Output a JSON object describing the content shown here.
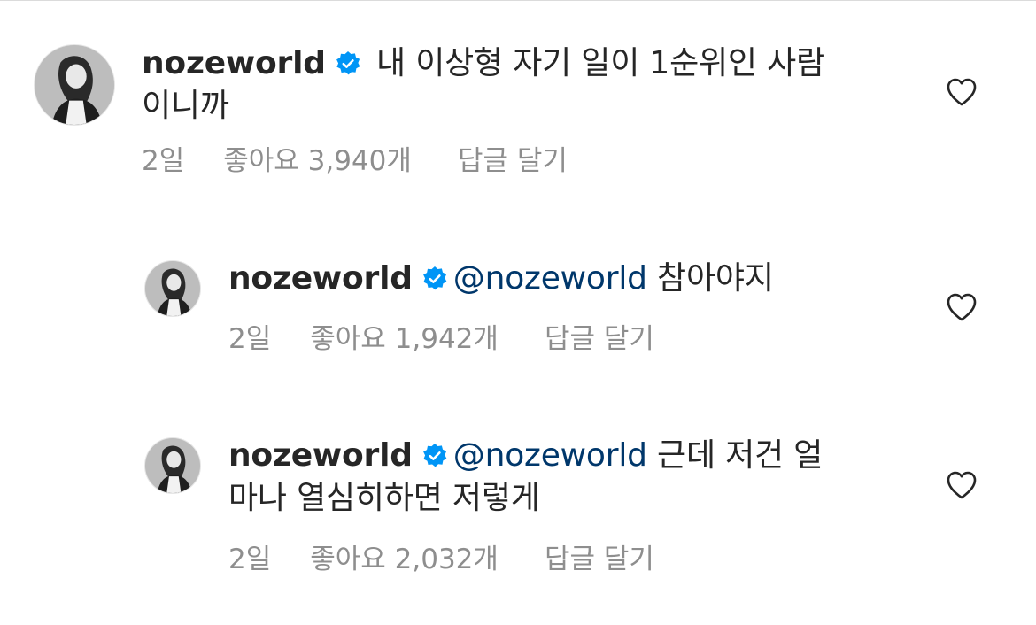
{
  "comments": [
    {
      "username": "nozeworld",
      "mention": "",
      "text_line1": " 내 이상형 자기 일이 1순위인 사람",
      "text_line2": "이니까",
      "time": "2일",
      "likes": "좋아요 3,940개",
      "reply": "답글 달기",
      "avatar_icon": "profile-photo",
      "verified_icon": "verified-badge-icon",
      "like_icon": "heart-outline-icon"
    },
    {
      "username": "nozeworld",
      "mention": "@nozeworld",
      "text_line1": " 참아야지",
      "text_line2": "",
      "time": "2일",
      "likes": "좋아요 1,942개",
      "reply": "답글 달기",
      "avatar_icon": "profile-photo",
      "verified_icon": "verified-badge-icon",
      "like_icon": "heart-outline-icon"
    },
    {
      "username": "nozeworld",
      "mention": "@nozeworld",
      "text_line1": " 근데 저건 얼",
      "text_line2": "마나 열심히하면 저렇게",
      "time": "2일",
      "likes": "좋아요 2,032개",
      "reply": "답글 달기",
      "avatar_icon": "profile-photo",
      "verified_icon": "verified-badge-icon",
      "like_icon": "heart-outline-icon"
    }
  ],
  "colors": {
    "text": "#262626",
    "meta": "#8e8e8e",
    "mention": "#00376b",
    "verified": "#0095f6"
  }
}
